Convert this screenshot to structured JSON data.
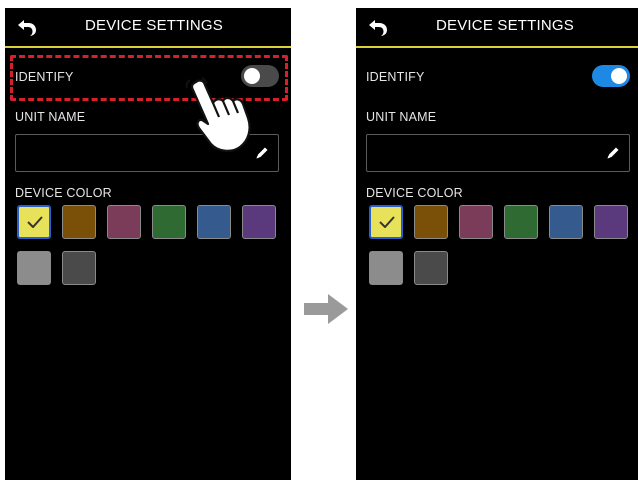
{
  "screens": [
    {
      "title": "DEVICE SETTINGS",
      "identify_label": "IDENTIFY",
      "identify_on": false,
      "unit_name_label": "UNIT NAME",
      "unit_name_value": "",
      "device_color_label": "DEVICE COLOR",
      "selected_color_index": 0
    },
    {
      "title": "DEVICE SETTINGS",
      "identify_label": "IDENTIFY",
      "identify_on": true,
      "unit_name_label": "UNIT NAME",
      "unit_name_value": "",
      "device_color_label": "DEVICE COLOR",
      "selected_color_index": 0
    }
  ],
  "device_colors": [
    "#e8e15a",
    "#7a4f08",
    "#7b3c5a",
    "#2f6a33",
    "#345a8e",
    "#5a3a7c",
    "#8c8c8c",
    "#4a4a4a"
  ],
  "colors": {
    "header_underline": "#d9d23c",
    "toggle_on": "#1e88e5",
    "toggle_off": "#4a4a4a",
    "highlight": "#d8202a",
    "selected_border": "#2a5fcf",
    "arrow": "#9a9a9a"
  },
  "icons": {
    "back": "back-arrow-icon",
    "edit": "pencil-icon",
    "check": "check-icon",
    "tap": "pointing-hand-icon",
    "transition": "right-arrow-icon"
  }
}
